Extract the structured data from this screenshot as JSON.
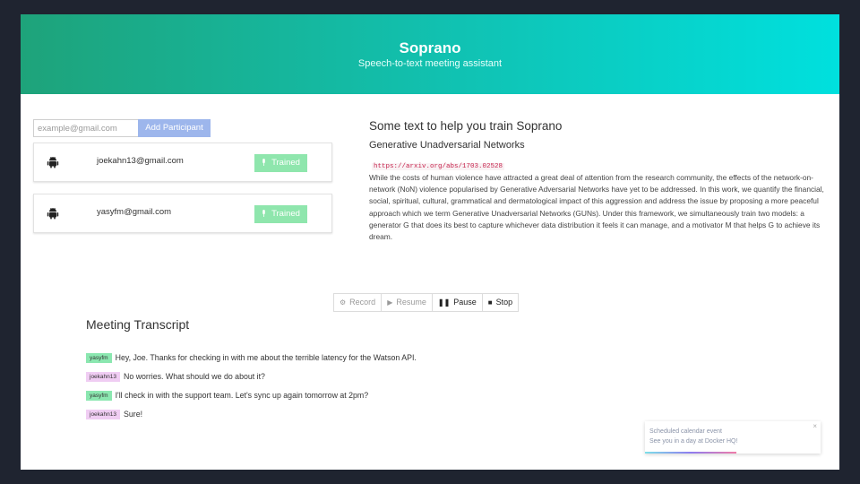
{
  "header": {
    "title": "Soprano",
    "subtitle": "Speech-to-text meeting assistant"
  },
  "participants": {
    "input_placeholder": "example@gmail.com",
    "add_label": "Add Participant",
    "list": [
      {
        "email": "joekahn13@gmail.com",
        "status": "Trained",
        "icon": "android-icon"
      },
      {
        "email": "yasyfm@gmail.com",
        "status": "Trained",
        "icon": "android-icon"
      }
    ],
    "status_color": "#8fe6ad"
  },
  "training": {
    "title": "Some text to help you train Soprano",
    "subtitle": "Generative Unadversarial Networks",
    "link": "https://arxiv.org/abs/1703.02528",
    "body": "While the costs of human violence have attracted a great deal of attention from the research community, the effects of the network-on-network (NoN) violence popularised by Generative Adversarial Networks have yet to be addressed. In this work, we quantify the financial, social, spiritual, cultural, grammatical and dermatological impact of this aggression and address the issue by proposing a more peaceful approach which we term Generative Unadversarial Networks (GUNs). Under this framework, we simultaneously train two models: a generator G that does its best to capture whichever data distribution it feels it can manage, and a motivator M that helps G to achieve its dream."
  },
  "controls": {
    "record": {
      "label": "Record",
      "icon": "gear-icon"
    },
    "resume": {
      "label": "Resume",
      "icon": "play-icon"
    },
    "pause": {
      "label": "Pause",
      "icon": "pause-icon"
    },
    "stop": {
      "label": "Stop",
      "icon": "stop-icon"
    }
  },
  "transcript": {
    "title": "Meeting Transcript",
    "lines": [
      {
        "speaker": "yasyfm",
        "text": "Hey, Joe. Thanks for checking in with me about the terrible latency for the Watson API."
      },
      {
        "speaker": "joekahn13",
        "text": "No worries. What should we do about it?"
      },
      {
        "speaker": "yasyfm",
        "text": "I'll check in with the support team. Let's sync up again tomorrow at 2pm?"
      },
      {
        "speaker": "joekahn13",
        "text": "Sure!"
      }
    ],
    "colors": {
      "yasyfm": "#8be7b0",
      "joekahn13": "#f0cdf3"
    }
  },
  "notification": {
    "title": "Scheduled calendar event",
    "message": "See you in a day at Docker HQ!",
    "close_glyph": "×"
  }
}
